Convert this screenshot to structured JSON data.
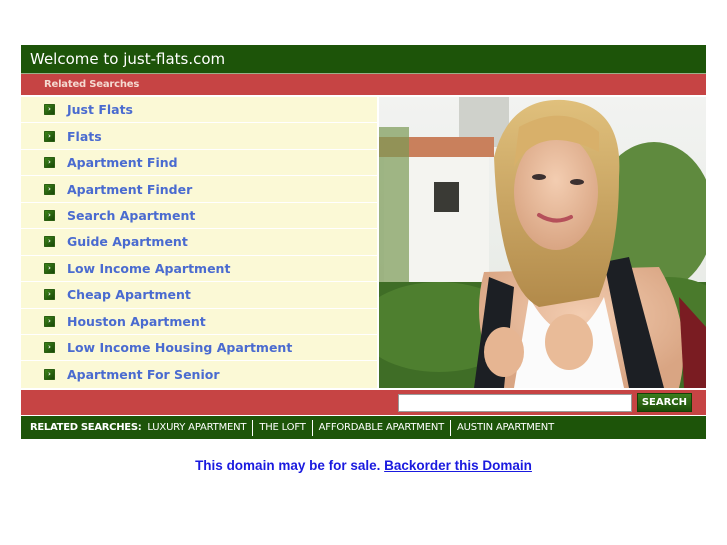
{
  "header": {
    "title": "Welcome to just-flats.com"
  },
  "related_label": "Related Searches",
  "links": [
    {
      "label": "Just Flats"
    },
    {
      "label": "Flats"
    },
    {
      "label": "Apartment Find"
    },
    {
      "label": "Apartment Finder"
    },
    {
      "label": "Search Apartment"
    },
    {
      "label": "Guide Apartment"
    },
    {
      "label": "Low Income Apartment"
    },
    {
      "label": "Cheap Apartment"
    },
    {
      "label": "Houston Apartment"
    },
    {
      "label": "Low Income Housing Apartment"
    },
    {
      "label": "Apartment For Senior"
    }
  ],
  "bullet_icon": "arrow-right-bullet-icon",
  "photo": {
    "description": "smiling blonde student wearing a backpack in front of campus building"
  },
  "search": {
    "value": "",
    "placeholder": "",
    "button_label": "SEARCH"
  },
  "bottom_bar": {
    "label": "RELATED SEARCHES:",
    "links": [
      "LUXURY APARTMENT",
      "THE LOFT",
      "AFFORDABLE APARTMENT",
      "AUSTIN APARTMENT"
    ]
  },
  "footer": {
    "sale_text": "This domain may be for sale.",
    "backorder_link": "Backorder this Domain"
  },
  "colors": {
    "green": "#1d5409",
    "red": "#c64444",
    "cream": "#fbf9d6",
    "link_blue": "#4a6bd0",
    "sale_blue": "#1a1adf"
  }
}
